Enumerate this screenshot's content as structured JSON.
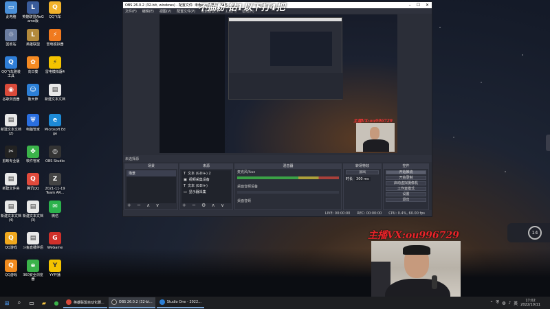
{
  "desktop_icons": [
    {
      "label": "此电脑",
      "glyph": "▭",
      "color": "#4a90d9"
    },
    {
      "label": "英雄联盟WeGame版",
      "glyph": "L",
      "color": "#3a5c9a"
    },
    {
      "label": "QQ飞车",
      "glyph": "Q",
      "color": "#f1b22b"
    },
    {
      "label": "回收站",
      "glyph": "♲",
      "color": "#6b7da0"
    },
    {
      "label": "英雄联盟",
      "glyph": "L",
      "color": "#b38a3c"
    },
    {
      "label": "雷电模拟器",
      "glyph": "⚡",
      "color": "#f07a1e"
    },
    {
      "label": "QQ飞车雅装工具",
      "glyph": "Q",
      "color": "#2f7ed8"
    },
    {
      "label": "向日葵",
      "glyph": "✿",
      "color": "#f58a22"
    },
    {
      "label": "雷电模拟器4",
      "glyph": "⚡",
      "color": "#f4c300"
    },
    {
      "label": "谷歌浏览器",
      "glyph": "◉",
      "color": "#d94a3a"
    },
    {
      "label": "鲁大师",
      "glyph": "☺",
      "color": "#2c7fd6"
    },
    {
      "label": "新建文本文档",
      "glyph": "▤",
      "color": "#e8e8e8"
    },
    {
      "label": "新建文本文档(2)",
      "glyph": "▤",
      "color": "#e8e8e8"
    },
    {
      "label": "电脑管家",
      "glyph": "⛨",
      "color": "#2a6fe0"
    },
    {
      "label": "Microsoft Edge",
      "glyph": "e",
      "color": "#1d8ad6"
    },
    {
      "label": "剪映专业版",
      "glyph": "✂",
      "color": "#222"
    },
    {
      "label": "软件管家",
      "glyph": "✤",
      "color": "#3bb34a"
    },
    {
      "label": "OBS Studio",
      "glyph": "◎",
      "color": "#333"
    },
    {
      "label": "新建文件夹",
      "glyph": "▤",
      "color": "#e8e8e8"
    },
    {
      "label": "腾讯QQ",
      "glyph": "Q",
      "color": "#e14a3c"
    },
    {
      "label": "2021-11-19 Team AR...",
      "glyph": "Z",
      "color": "#444"
    },
    {
      "label": "新建文本文档(4)",
      "glyph": "▤",
      "color": "#e8e8e8"
    },
    {
      "label": "新建文本文档(3)",
      "glyph": "▤",
      "color": "#e8e8e8"
    },
    {
      "label": "微信",
      "glyph": "✉",
      "color": "#2bb24c"
    },
    {
      "label": "QQ游戏",
      "glyph": "Q",
      "color": "#f0a81e"
    },
    {
      "label": "斗鱼直播伴侣",
      "glyph": "▤",
      "color": "#e8e8e8"
    },
    {
      "label": "WeGame",
      "glyph": "G",
      "color": "#d0302a"
    },
    {
      "label": "QQ游戏",
      "glyph": "Q",
      "color": "#f08a1e"
    },
    {
      "label": "360安全浏览器",
      "glyph": "e",
      "color": "#3bb34a"
    },
    {
      "label": "YY开播",
      "glyph": "Y",
      "color": "#f4c300"
    },
    {
      "label": "YY语音",
      "glyph": "Y",
      "color": "#f4c300"
    },
    {
      "label": "雷电多开器4",
      "glyph": "⚡",
      "color": "#f4c300"
    }
  ],
  "obs": {
    "title": "OBS 26.0.2 (32-bit, windows) - 配置文件: 未命名 - 场景: 未命名",
    "menu": [
      "文件(F)",
      "编辑(E)",
      "视图(V)",
      "配置文件(P)",
      "场景集合(S)",
      "工具(T)",
      "帮助(H)"
    ],
    "source_bar": "未选择源",
    "docks": {
      "scenes": {
        "title": "场景",
        "items": [
          "场景"
        ]
      },
      "sources": {
        "title": "来源",
        "items": [
          "文本 (GDI+) 2",
          "视频采集设备",
          "文本 (GDI+)",
          "显示器采集"
        ]
      },
      "mixer": {
        "title": "混音器",
        "channels": [
          "麦克风/Aux",
          "桌面音频设备",
          "桌面音频"
        ]
      },
      "transitions": {
        "title": "转场特效",
        "type": "淡出",
        "duration_label": "时长",
        "duration": "300 ms"
      },
      "controls": {
        "title": "控件",
        "buttons": [
          "开始推流",
          "开始录制",
          "启动虚拟摄像机",
          "工作室模式",
          "设置",
          "退出"
        ]
      }
    },
    "status": {
      "live": "LIVE: 00:00:00",
      "rec": "REC: 00:00:00",
      "cpu": "CPU: 0.4%, 60.00 fps"
    }
  },
  "overlays": {
    "top_banner": "不抽粉 钻1以下打4把",
    "streamer_vx": "主播VX:ou996729",
    "inner_vx": "主播VX:ou996729"
  },
  "widget": {
    "value": "14"
  },
  "taskbar": {
    "apps": [
      {
        "label": "英雄联盟自动化脚...",
        "color": "#d94a3a"
      },
      {
        "label": "OBS 26.0.2 (32-bi...",
        "color": "#333"
      },
      {
        "label": "Studio One - 2022...",
        "color": "#2c7fd6"
      }
    ],
    "time": "17:02",
    "date": "2022/10/11"
  }
}
